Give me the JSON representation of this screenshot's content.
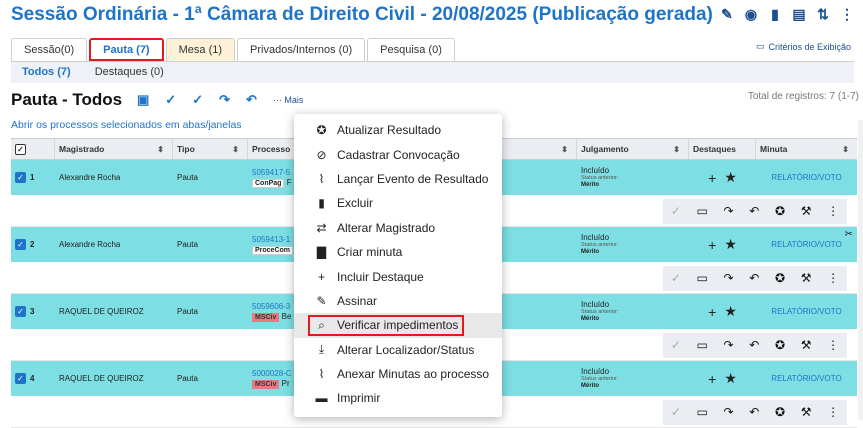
{
  "title": "Sessão Ordinária - 1ª Câmara de Direito Civil - 20/08/2025 (Publicação gerada)",
  "title_icons": [
    "pencil-icon",
    "broadcast-icon",
    "door-icon",
    "file-add-icon",
    "sort-icon",
    "more-vertical-icon"
  ],
  "tabs": [
    {
      "label": "Sessão(0)"
    },
    {
      "label": "Pauta (7)"
    },
    {
      "label": "Mesa (1)"
    },
    {
      "label": "Privados/Internos (0)"
    },
    {
      "label": "Pesquisa (0)"
    }
  ],
  "criterios": "Critérios de Exibição",
  "subtabs": [
    {
      "label": "Todos (7)"
    },
    {
      "label": "Destaques (0)"
    }
  ],
  "pauta_title": "Pauta - Todos",
  "toolbar": {
    "mais": "Mais"
  },
  "total": "Total de registros: 7 (1-7)",
  "abrir_link": "Abrir os processos selecionados em abas/janelas",
  "table": {
    "headers": {
      "magistrado": "Magistrado",
      "tipo": "Tipo",
      "processo": "Processo",
      "julgamento": "Julgamento",
      "destaques": "Destaques",
      "minuta": "Minuta"
    },
    "rows": [
      {
        "n": "1",
        "magistrado": "Alexandre Rocha",
        "tipo": "Pauta",
        "processo": "5059417-5",
        "tag": "ConPag",
        "tag_suffix": "F",
        "tag_red": false,
        "julg": "Incluído",
        "status_label": "Status anterior:",
        "merito": "Mérito",
        "minuta": "RELATÓRIO/VOTO",
        "scissors": false
      },
      {
        "n": "2",
        "magistrado": "Alexandre Rocha",
        "tipo": "Pauta",
        "processo": "5059413-1",
        "tag": "ProceCom",
        "tag_suffix": "",
        "tag_red": false,
        "julg": "Incluído",
        "status_label": "Status anterior:",
        "merito": "Mérito",
        "minuta": "RELATÓRIO/VOTO",
        "scissors": true
      },
      {
        "n": "3",
        "magistrado": "RAQUEL DE QUEIROZ",
        "tipo": "Pauta",
        "processo": "5059606-3",
        "tag": "MSCiv",
        "tag_suffix": "Be",
        "tag_red": true,
        "julg": "Incluído",
        "status_label": "Status anterior:",
        "merito": "Mérito",
        "minuta": "RELATÓRIO/VOTO",
        "scissors": false
      },
      {
        "n": "4",
        "magistrado": "RAQUEL DE QUEIROZ",
        "tipo": "Pauta",
        "processo": "5000028-C",
        "tag": "MSCiv",
        "tag_suffix": "Pr",
        "tag_red": true,
        "julg": "Incluído",
        "status_label": "Status anterior:",
        "merito": "Mérito",
        "minuta": "RELATÓRIO/VOTO",
        "scissors": false
      }
    ]
  },
  "menu": [
    {
      "label": "Atualizar Resultado",
      "icon": "badge-check-icon"
    },
    {
      "label": "Cadastrar Convocação",
      "icon": "block-icon"
    },
    {
      "label": "Lançar Evento de Resultado",
      "icon": "paperclip-icon"
    },
    {
      "label": "Excluir",
      "icon": "trash-icon"
    },
    {
      "label": "Alterar Magistrado",
      "icon": "swap-icon"
    },
    {
      "label": "Criar minuta",
      "icon": "file-icon"
    },
    {
      "label": "Incluir Destaque",
      "icon": "plus-icon"
    },
    {
      "label": "Assinar",
      "icon": "pen-icon"
    },
    {
      "label": "Verificar impedimentos",
      "icon": "search-person-icon"
    },
    {
      "label": "Alterar Localizador/Status",
      "icon": "download-icon"
    },
    {
      "label": "Anexar Minutas ao processo",
      "icon": "paperclip-icon"
    },
    {
      "label": "Imprimir",
      "icon": "printer-icon"
    }
  ]
}
